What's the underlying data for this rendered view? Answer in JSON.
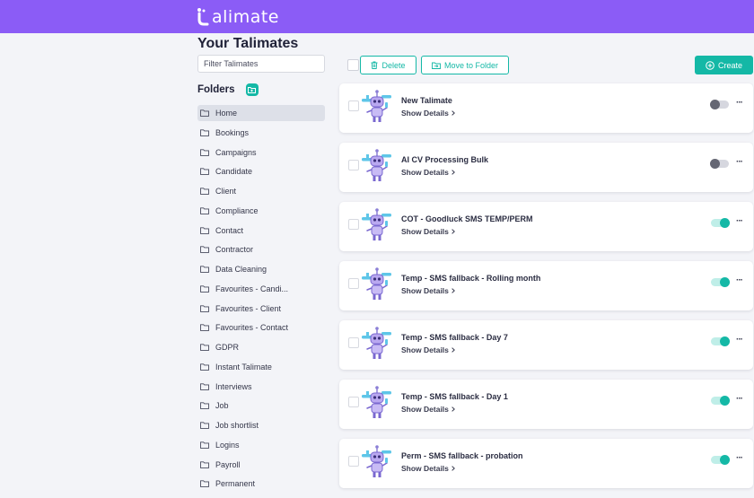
{
  "header": {
    "logo_text": "alimate"
  },
  "page_title": "Your Talimates",
  "filter": {
    "placeholder": "Filter Talimates"
  },
  "folders": {
    "title": "Folders",
    "items": [
      {
        "label": "Home",
        "active": true
      },
      {
        "label": "Bookings"
      },
      {
        "label": "Campaigns"
      },
      {
        "label": "Candidate"
      },
      {
        "label": "Client"
      },
      {
        "label": "Compliance"
      },
      {
        "label": "Contact"
      },
      {
        "label": "Contractor"
      },
      {
        "label": "Data Cleaning"
      },
      {
        "label": "Favourites - Candi..."
      },
      {
        "label": "Favourites - Client"
      },
      {
        "label": "Favourites - Contact"
      },
      {
        "label": "GDPR"
      },
      {
        "label": "Instant Talimate"
      },
      {
        "label": "Interviews"
      },
      {
        "label": "Job"
      },
      {
        "label": "Job shortlist"
      },
      {
        "label": "Logins"
      },
      {
        "label": "Payroll"
      },
      {
        "label": "Permanent"
      }
    ]
  },
  "toolbar": {
    "delete_label": "Delete",
    "move_label": "Move to Folder",
    "create_label": "Create"
  },
  "talimates": [
    {
      "name": "New Talimate",
      "details_label": "Show Details",
      "enabled": false
    },
    {
      "name": "AI CV Processing Bulk",
      "details_label": "Show Details",
      "enabled": false
    },
    {
      "name": "COT - Goodluck SMS TEMP/PERM",
      "details_label": "Show Details",
      "enabled": true
    },
    {
      "name": "Temp - SMS fallback - Rolling month",
      "details_label": "Show Details",
      "enabled": true
    },
    {
      "name": "Temp - SMS fallback - Day 7",
      "details_label": "Show Details",
      "enabled": true
    },
    {
      "name": "Temp - SMS fallback - Day 1",
      "details_label": "Show Details",
      "enabled": true
    },
    {
      "name": "Perm - SMS fallback - probation",
      "details_label": "Show Details",
      "enabled": true
    }
  ],
  "icons": {
    "logo": "talimate-logo-icon",
    "folder": "folder-icon",
    "add_folder": "add-folder-icon",
    "delete": "trash-icon",
    "move": "folder-move-icon",
    "create": "plus-circle-icon",
    "robot": "robot-avatar-icon",
    "chevron": "chevron-right-icon",
    "more": "more-dots-icon"
  },
  "colors": {
    "header": "#8b5cf6",
    "accent": "#14b8a6",
    "background": "#f3f4f8"
  }
}
